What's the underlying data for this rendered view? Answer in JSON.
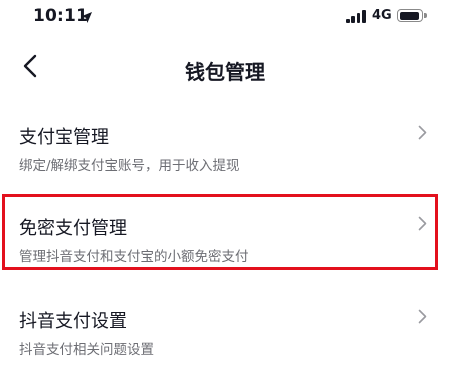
{
  "status_bar": {
    "time": "10:11",
    "network": "4G",
    "location_icon": "location-arrow-icon",
    "signal_icon": "cellular-signal-icon",
    "battery_icon": "battery-icon"
  },
  "nav": {
    "back_icon": "chevron-left-icon",
    "title": "钱包管理"
  },
  "menu": [
    {
      "title": "支付宝管理",
      "subtitle": "绑定/解绑支付宝账号，用于收入提现",
      "icon": "chevron-right-icon"
    },
    {
      "title": "免密支付管理",
      "subtitle": "管理抖音支付和支付宝的小额免密支付",
      "icon": "chevron-right-icon",
      "highlighted": true
    },
    {
      "title": "抖音支付设置",
      "subtitle": "抖音支付相关问题设置",
      "icon": "chevron-right-icon"
    }
  ],
  "colors": {
    "text_primary": "#161823",
    "text_secondary": "#6d6e74",
    "highlight_border": "#e3101d",
    "chevron": "#9a9ba0"
  }
}
